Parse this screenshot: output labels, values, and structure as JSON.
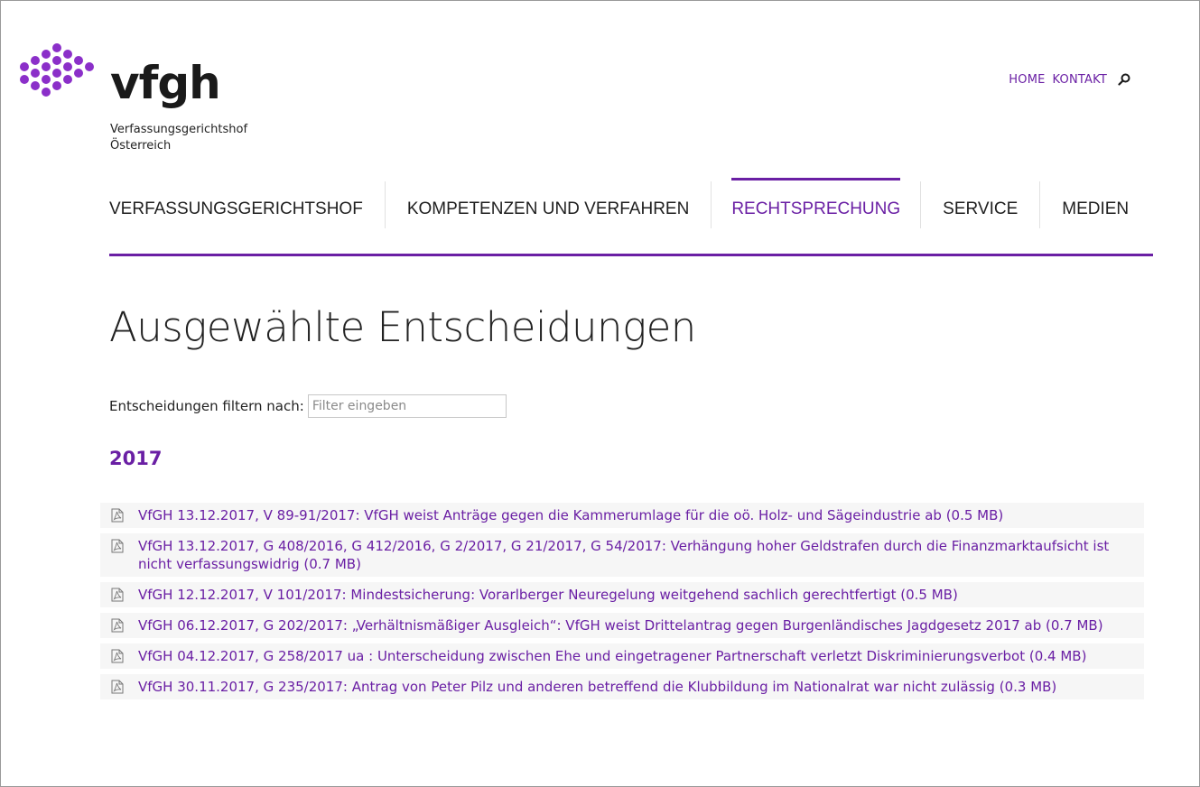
{
  "brand": {
    "name": "vfgh",
    "subtitle_line1": "Verfassungsgerichtshof",
    "subtitle_line2": "Österreich",
    "accent_color": "#6a1fa4"
  },
  "top_links": {
    "home": "HOME",
    "contact": "KONTAKT",
    "search_icon": "search-icon"
  },
  "nav": {
    "items": [
      {
        "label": "VERFASSUNGSGERICHTSHOF",
        "active": false
      },
      {
        "label": "KOMPETENZEN UND VERFAHREN",
        "active": false
      },
      {
        "label": "RECHTSPRECHUNG",
        "active": true
      },
      {
        "label": "SERVICE",
        "active": false
      },
      {
        "label": "MEDIEN",
        "active": false
      }
    ]
  },
  "page": {
    "title": "Ausgewählte Entscheidungen"
  },
  "filter": {
    "label": "Entscheidungen filtern nach:",
    "placeholder": "Filter eingeben",
    "value": ""
  },
  "year": "2017",
  "decisions": [
    {
      "icon": "pdf-icon",
      "text": "VfGH 13.12.2017, V 89-91/2017: VfGH weist Anträge gegen die Kammerumlage für die oö. Holz- und Sägeindustrie ab (0.5 MB)"
    },
    {
      "icon": "pdf-icon",
      "text": "VfGH 13.12.2017, G 408/2016, G 412/2016, G 2/2017, G 21/2017, G 54/2017: Verhängung hoher Geldstrafen durch die Finanzmarktaufsicht ist nicht verfassungswidrig (0.7 MB)"
    },
    {
      "icon": "pdf-icon",
      "text": "VfGH 12.12.2017, V 101/2017: Mindestsicherung: Vorarlberger Neuregelung weitgehend sachlich gerechtfertigt (0.5 MB)"
    },
    {
      "icon": "pdf-icon",
      "text": "VfGH 06.12.2017, G 202/2017: „Verhältnismäßiger Ausgleich“: VfGH weist Drittelantrag gegen Burgenländisches Jagdgesetz 2017 ab (0.7 MB)"
    },
    {
      "icon": "pdf-icon",
      "text": "VfGH 04.12.2017, G 258/2017 ua : Unterscheidung zwischen Ehe und eingetragener Partnerschaft verletzt Diskriminierungsverbot (0.4 MB)"
    },
    {
      "icon": "pdf-icon",
      "text": "VfGH 30.11.2017, G 235/2017: Antrag von Peter Pilz und anderen betreffend die Klubbildung im Nationalrat war nicht zulässig (0.3 MB)"
    }
  ]
}
